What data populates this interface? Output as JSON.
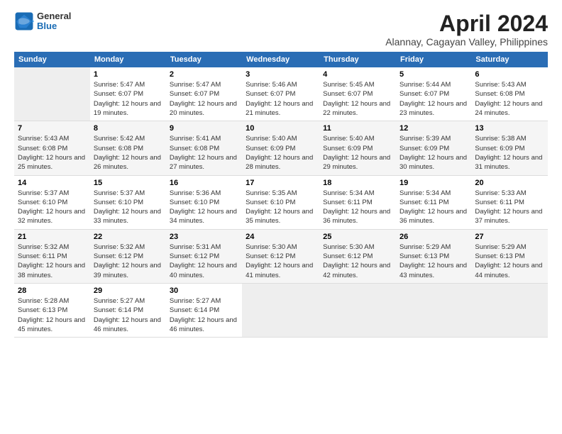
{
  "logo": {
    "general": "General",
    "blue": "Blue"
  },
  "title": {
    "month_year": "April 2024",
    "location": "Alannay, Cagayan Valley, Philippines"
  },
  "days_of_week": [
    "Sunday",
    "Monday",
    "Tuesday",
    "Wednesday",
    "Thursday",
    "Friday",
    "Saturday"
  ],
  "weeks": [
    [
      {
        "day": "",
        "sunrise": "",
        "sunset": "",
        "daylight": ""
      },
      {
        "day": "1",
        "sunrise": "Sunrise: 5:47 AM",
        "sunset": "Sunset: 6:07 PM",
        "daylight": "Daylight: 12 hours and 19 minutes."
      },
      {
        "day": "2",
        "sunrise": "Sunrise: 5:47 AM",
        "sunset": "Sunset: 6:07 PM",
        "daylight": "Daylight: 12 hours and 20 minutes."
      },
      {
        "day": "3",
        "sunrise": "Sunrise: 5:46 AM",
        "sunset": "Sunset: 6:07 PM",
        "daylight": "Daylight: 12 hours and 21 minutes."
      },
      {
        "day": "4",
        "sunrise": "Sunrise: 5:45 AM",
        "sunset": "Sunset: 6:07 PM",
        "daylight": "Daylight: 12 hours and 22 minutes."
      },
      {
        "day": "5",
        "sunrise": "Sunrise: 5:44 AM",
        "sunset": "Sunset: 6:07 PM",
        "daylight": "Daylight: 12 hours and 23 minutes."
      },
      {
        "day": "6",
        "sunrise": "Sunrise: 5:43 AM",
        "sunset": "Sunset: 6:08 PM",
        "daylight": "Daylight: 12 hours and 24 minutes."
      }
    ],
    [
      {
        "day": "7",
        "sunrise": "Sunrise: 5:43 AM",
        "sunset": "Sunset: 6:08 PM",
        "daylight": "Daylight: 12 hours and 25 minutes."
      },
      {
        "day": "8",
        "sunrise": "Sunrise: 5:42 AM",
        "sunset": "Sunset: 6:08 PM",
        "daylight": "Daylight: 12 hours and 26 minutes."
      },
      {
        "day": "9",
        "sunrise": "Sunrise: 5:41 AM",
        "sunset": "Sunset: 6:08 PM",
        "daylight": "Daylight: 12 hours and 27 minutes."
      },
      {
        "day": "10",
        "sunrise": "Sunrise: 5:40 AM",
        "sunset": "Sunset: 6:09 PM",
        "daylight": "Daylight: 12 hours and 28 minutes."
      },
      {
        "day": "11",
        "sunrise": "Sunrise: 5:40 AM",
        "sunset": "Sunset: 6:09 PM",
        "daylight": "Daylight: 12 hours and 29 minutes."
      },
      {
        "day": "12",
        "sunrise": "Sunrise: 5:39 AM",
        "sunset": "Sunset: 6:09 PM",
        "daylight": "Daylight: 12 hours and 30 minutes."
      },
      {
        "day": "13",
        "sunrise": "Sunrise: 5:38 AM",
        "sunset": "Sunset: 6:09 PM",
        "daylight": "Daylight: 12 hours and 31 minutes."
      }
    ],
    [
      {
        "day": "14",
        "sunrise": "Sunrise: 5:37 AM",
        "sunset": "Sunset: 6:10 PM",
        "daylight": "Daylight: 12 hours and 32 minutes."
      },
      {
        "day": "15",
        "sunrise": "Sunrise: 5:37 AM",
        "sunset": "Sunset: 6:10 PM",
        "daylight": "Daylight: 12 hours and 33 minutes."
      },
      {
        "day": "16",
        "sunrise": "Sunrise: 5:36 AM",
        "sunset": "Sunset: 6:10 PM",
        "daylight": "Daylight: 12 hours and 34 minutes."
      },
      {
        "day": "17",
        "sunrise": "Sunrise: 5:35 AM",
        "sunset": "Sunset: 6:10 PM",
        "daylight": "Daylight: 12 hours and 35 minutes."
      },
      {
        "day": "18",
        "sunrise": "Sunrise: 5:34 AM",
        "sunset": "Sunset: 6:11 PM",
        "daylight": "Daylight: 12 hours and 36 minutes."
      },
      {
        "day": "19",
        "sunrise": "Sunrise: 5:34 AM",
        "sunset": "Sunset: 6:11 PM",
        "daylight": "Daylight: 12 hours and 36 minutes."
      },
      {
        "day": "20",
        "sunrise": "Sunrise: 5:33 AM",
        "sunset": "Sunset: 6:11 PM",
        "daylight": "Daylight: 12 hours and 37 minutes."
      }
    ],
    [
      {
        "day": "21",
        "sunrise": "Sunrise: 5:32 AM",
        "sunset": "Sunset: 6:11 PM",
        "daylight": "Daylight: 12 hours and 38 minutes."
      },
      {
        "day": "22",
        "sunrise": "Sunrise: 5:32 AM",
        "sunset": "Sunset: 6:12 PM",
        "daylight": "Daylight: 12 hours and 39 minutes."
      },
      {
        "day": "23",
        "sunrise": "Sunrise: 5:31 AM",
        "sunset": "Sunset: 6:12 PM",
        "daylight": "Daylight: 12 hours and 40 minutes."
      },
      {
        "day": "24",
        "sunrise": "Sunrise: 5:30 AM",
        "sunset": "Sunset: 6:12 PM",
        "daylight": "Daylight: 12 hours and 41 minutes."
      },
      {
        "day": "25",
        "sunrise": "Sunrise: 5:30 AM",
        "sunset": "Sunset: 6:12 PM",
        "daylight": "Daylight: 12 hours and 42 minutes."
      },
      {
        "day": "26",
        "sunrise": "Sunrise: 5:29 AM",
        "sunset": "Sunset: 6:13 PM",
        "daylight": "Daylight: 12 hours and 43 minutes."
      },
      {
        "day": "27",
        "sunrise": "Sunrise: 5:29 AM",
        "sunset": "Sunset: 6:13 PM",
        "daylight": "Daylight: 12 hours and 44 minutes."
      }
    ],
    [
      {
        "day": "28",
        "sunrise": "Sunrise: 5:28 AM",
        "sunset": "Sunset: 6:13 PM",
        "daylight": "Daylight: 12 hours and 45 minutes."
      },
      {
        "day": "29",
        "sunrise": "Sunrise: 5:27 AM",
        "sunset": "Sunset: 6:14 PM",
        "daylight": "Daylight: 12 hours and 46 minutes."
      },
      {
        "day": "30",
        "sunrise": "Sunrise: 5:27 AM",
        "sunset": "Sunset: 6:14 PM",
        "daylight": "Daylight: 12 hours and 46 minutes."
      },
      {
        "day": "",
        "sunrise": "",
        "sunset": "",
        "daylight": ""
      },
      {
        "day": "",
        "sunrise": "",
        "sunset": "",
        "daylight": ""
      },
      {
        "day": "",
        "sunrise": "",
        "sunset": "",
        "daylight": ""
      },
      {
        "day": "",
        "sunrise": "",
        "sunset": "",
        "daylight": ""
      }
    ]
  ]
}
